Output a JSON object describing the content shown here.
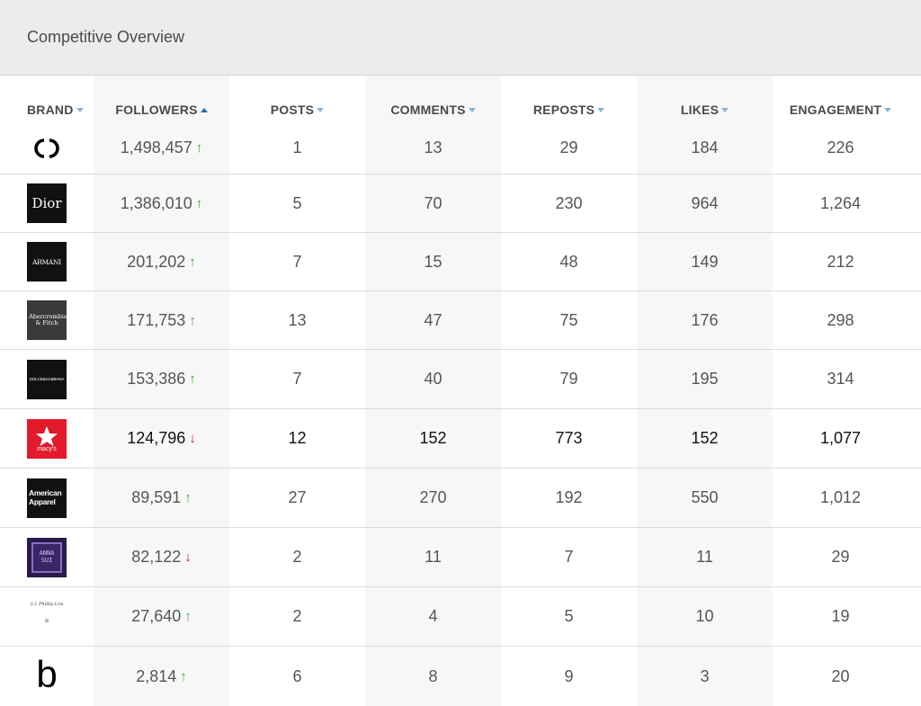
{
  "header": {
    "title": "Competitive Overview"
  },
  "columns": {
    "brand": "BRAND",
    "followers": "FOLLOWERS",
    "posts": "POSTS",
    "comments": "COMMENTS",
    "reposts": "REPOSTS",
    "likes": "LIKES",
    "engagement": "ENGAGEMENT"
  },
  "sort": {
    "column": "followers",
    "direction": "ascending-indicator"
  },
  "colors": {
    "trend_up": "#3aaa35",
    "trend_down": "#d0231c",
    "sort_caret": "#8ab4d9",
    "active_caret": "#1e6eb5",
    "stripe": "#f7f7f7"
  },
  "rows": [
    {
      "brand": "Chanel",
      "logo_icon": "chanel-logo-icon",
      "logo_text": "",
      "followers": "1,498,457",
      "trend": "up",
      "posts": "1",
      "comments": "13",
      "reposts": "29",
      "likes": "184",
      "engagement": "226"
    },
    {
      "brand": "Dior",
      "logo_icon": "dior-logo-icon",
      "logo_text": "Dior",
      "followers": "1,386,010",
      "trend": "up",
      "posts": "5",
      "comments": "70",
      "reposts": "230",
      "likes": "964",
      "engagement": "1,264"
    },
    {
      "brand": "Armani",
      "logo_icon": "armani-logo-icon",
      "logo_text": "ARMANI",
      "followers": "201,202",
      "trend": "up",
      "posts": "7",
      "comments": "15",
      "reposts": "48",
      "likes": "149",
      "engagement": "212"
    },
    {
      "brand": "Abercrombie & Fitch",
      "logo_icon": "abercrombie-logo-icon",
      "logo_text": "Abercrombie & Fitch",
      "followers": "171,753",
      "trend": "up",
      "posts": "13",
      "comments": "47",
      "reposts": "75",
      "likes": "176",
      "engagement": "298"
    },
    {
      "brand": "Dolce & Gabbana",
      "logo_icon": "dolce-gabbana-logo-icon",
      "logo_text": "DOLCE&GABBANA",
      "followers": "153,386",
      "trend": "up",
      "posts": "7",
      "comments": "40",
      "reposts": "79",
      "likes": "195",
      "engagement": "314"
    },
    {
      "brand": "Macy's",
      "logo_icon": "macys-logo-icon",
      "logo_text": "macy's",
      "followers": "124,796",
      "trend": "down",
      "posts": "12",
      "comments": "152",
      "reposts": "773",
      "likes": "152",
      "engagement": "1,077",
      "highlight": true
    },
    {
      "brand": "American Apparel",
      "logo_icon": "american-apparel-logo-icon",
      "logo_text": "American Apparel",
      "followers": "89,591",
      "trend": "up",
      "posts": "27",
      "comments": "270",
      "reposts": "192",
      "likes": "550",
      "engagement": "1,012"
    },
    {
      "brand": "Anna Sui",
      "logo_icon": "anna-sui-logo-icon",
      "logo_text": "ANNA SUI",
      "followers": "82,122",
      "trend": "down",
      "posts": "2",
      "comments": "11",
      "reposts": "7",
      "likes": "11",
      "engagement": "29"
    },
    {
      "brand": "3.1 Phillip Lim",
      "logo_icon": "phillip-lim-logo-icon",
      "logo_text": "3.1 Phillip Lim",
      "followers": "27,640",
      "trend": "up",
      "posts": "2",
      "comments": "4",
      "reposts": "5",
      "likes": "10",
      "engagement": "19"
    },
    {
      "brand": "b",
      "logo_icon": "b-logo-icon",
      "logo_text": "b",
      "followers": "2,814",
      "trend": "up",
      "posts": "6",
      "comments": "8",
      "reposts": "9",
      "likes": "3",
      "engagement": "20"
    }
  ]
}
